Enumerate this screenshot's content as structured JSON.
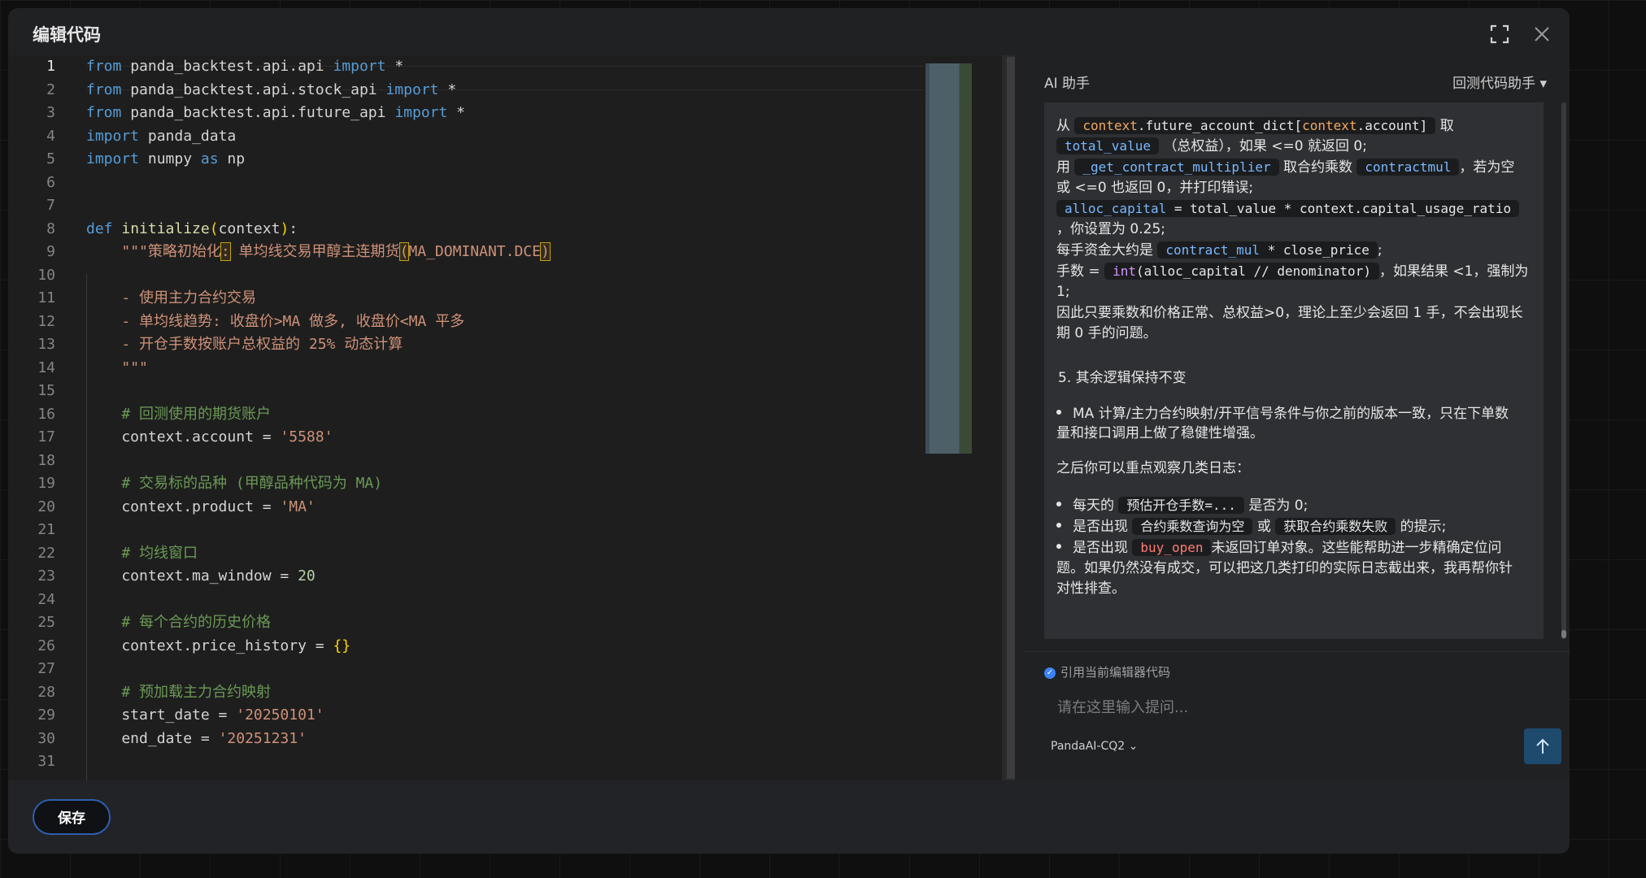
{
  "modal": {
    "title": "编辑代码",
    "expand_icon": "fullscreen-icon",
    "close_icon": "close-icon"
  },
  "editor": {
    "active_line": 1,
    "line_numbers": [
      "1",
      "2",
      "3",
      "4",
      "5",
      "6",
      "7",
      "8",
      "9",
      "10",
      "11",
      "12",
      "13",
      "14",
      "15",
      "16",
      "17",
      "18",
      "19",
      "20",
      "21",
      "22",
      "23",
      "24",
      "25",
      "26",
      "27",
      "28",
      "29",
      "30",
      "31"
    ]
  },
  "assistant": {
    "title": "AI 助手",
    "mode_select": "回测代码助手 ▾",
    "message": {
      "l1_a": "从",
      "l1_code": "context.future_account_dict[context.account]",
      "l1_b": "取",
      "l2_code": "total_value",
      "l2_b": "（总权益），如果 <=0 就返回 0;",
      "l3_a": "用",
      "l3_code": "_get_contract_multiplier",
      "l3_b": "取合约乘数",
      "l3_code2": "contractmul",
      "l3_c": "，若为空",
      "l4": "或 <=0 也返回 0，并打印错误;",
      "l5_code": "alloc_capital = total_value * context.capital_usage_ratio",
      "l6": "，你设置为 0.25;",
      "l7_a": "每手资金大约是",
      "l7_code": "contract_mul * close_price",
      "l7_b": ";",
      "l8_a": "手数 =",
      "l8_code": "int(alloc_capital // denominator)",
      "l8_b": "，如果结果 <1，强制为",
      "l9": "1;",
      "l10": "因此只要乘数和价格正常、总权益>0，理论上至少会返回 1 手，不会出现长",
      "l11": "期 0 手的问题。",
      "section5": "5. 其余逻辑保持不变",
      "b1_a": "MA 计算/主力合约映射/开平信号条件与你之前的版本一致，只在下单数",
      "b1_b": "量和接口调用上做了稳健性增强。",
      "after": "之后你可以重点观察几类日志：",
      "b2_a": "每天的",
      "b2_code": "预估开仓手数=...",
      "b2_b": "是否为 0;",
      "b3_a": "是否出现",
      "b3_code": "合约乘数查询为空",
      "b3_b": "或",
      "b3_code2": "获取合约乘数失败",
      "b3_c": "的提示;",
      "b4_a": "是否出现",
      "b4_code": "buy_open",
      "b4_b": "未返回订单对象",
      "b4_c": "。这些能帮助进一步精确定位问",
      "b4_d": "题。如果仍然没有成交，可以把这几类打印的实际日志截出来，我再帮你针",
      "b4_e": "对性排查。"
    },
    "cite_label": "引用当前编辑器代码",
    "input_placeholder": "请在这里输入提问...",
    "model": "PandaAI-CQ2 ⌄",
    "send_icon": "arrow-up-icon"
  },
  "footer": {
    "save_label": "保存"
  },
  "colors": {
    "accent": "#2c5fae",
    "editor_bg": "#1e1e1e",
    "modal_bg": "#202123"
  }
}
